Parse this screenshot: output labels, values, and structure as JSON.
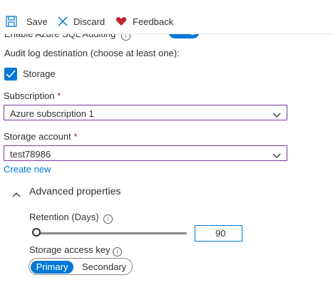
{
  "toolbar": {
    "save_label": "Save",
    "discard_label": "Discard",
    "feedback_label": "Feedback"
  },
  "auditing": {
    "label": "Enable Azure SQL Auditing",
    "enabled": true
  },
  "audit_destination": {
    "label": "Audit log destination (choose at least one):",
    "storage_label": "Storage",
    "storage_checked": true
  },
  "subscription": {
    "label": "Subscription",
    "required_mark": "*",
    "value": "Azure subscription 1"
  },
  "storage_account": {
    "label": "Storage account",
    "required_mark": "*",
    "value": "test78986",
    "create_new": "Create new"
  },
  "advanced": {
    "label": "Advanced properties",
    "retention_label": "Retention (Days)",
    "retention_value": "90",
    "access_key_label": "Storage access key",
    "access_key_options": [
      "Primary",
      "Secondary"
    ],
    "access_key_selected": "Primary"
  },
  "colors": {
    "accent": "#0078d4",
    "required": "#a4262c",
    "dropdown_border": "#7a3b9e",
    "feedback_heart": "#c4262e"
  }
}
